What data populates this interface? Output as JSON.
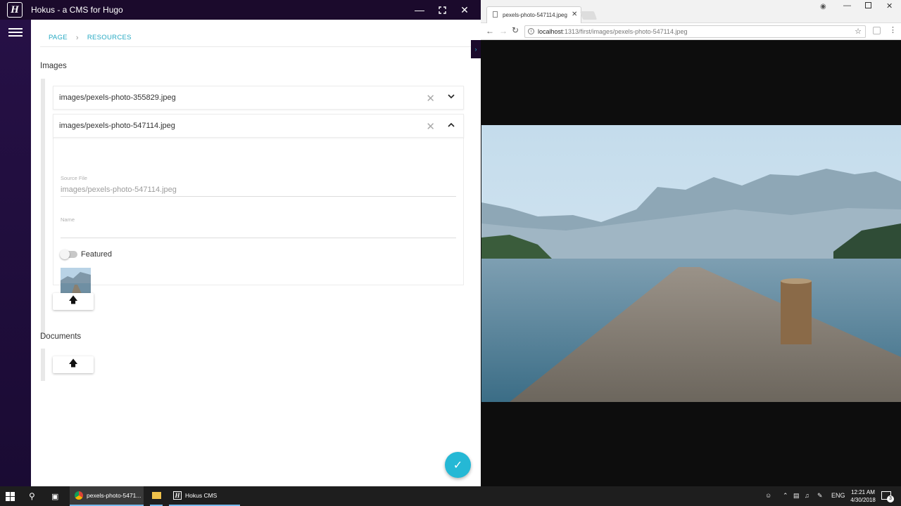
{
  "hokus": {
    "window_title": "Hokus - a CMS for Hugo",
    "logo_letter": "H",
    "breadcrumb": [
      "PAGE",
      "RESOURCES"
    ],
    "images_section": "Images",
    "image_items": [
      {
        "path": "images/pexels-photo-355829.jpeg",
        "expanded": false
      },
      {
        "path": "images/pexels-photo-547114.jpeg",
        "expanded": true
      }
    ],
    "source_file_label": "Source File",
    "source_file_value": "images/pexels-photo-547114.jpeg",
    "name_label": "Name",
    "name_value": "",
    "featured_label": "Featured",
    "featured_on": false,
    "documents_section": "Documents"
  },
  "browser": {
    "tab_title": "pexels-photo-547114.jpeg",
    "url_host": "localhost",
    "url_path": ":1313/first/images/pexels-photo-547114.jpeg"
  },
  "taskbar": {
    "chrome_app": "pexels-photo-5471...",
    "hokus_app": "Hokus CMS",
    "language": "ENG",
    "time": "12:21 AM",
    "date": "4/30/2018",
    "notification_count": "3"
  },
  "colors": {
    "accent": "#25b8d5",
    "sidebar": "#261046",
    "titlebar": "#1b0a2c"
  }
}
